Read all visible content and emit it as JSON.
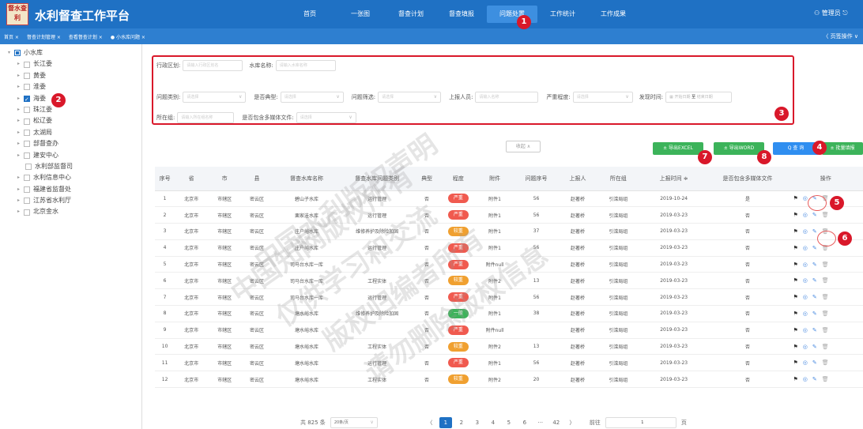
{
  "header": {
    "logo_text": "督水查利",
    "title": "水利督查工作平台",
    "user": "管理员"
  },
  "nav": {
    "items": [
      "首页",
      "一张图",
      "督查计划",
      "督查填报",
      "问题处置",
      "工作统计",
      "工作成果"
    ]
  },
  "tabs": {
    "items": [
      "首页 ×",
      "督查计划管理 ×",
      "查看督查计划 ×",
      "● 小水库问题 ×"
    ],
    "right": "〈 页签操作 ∨"
  },
  "tree": {
    "root": "小水库",
    "children": [
      "长江委",
      "黄委",
      "淮委",
      "海委",
      "珠江委",
      "松辽委",
      "太湖局",
      "部督查办",
      "建安中心"
    ],
    "leaves": [
      "水利部监督司",
      "水利信息中心",
      "福建省监督处",
      "江苏省水利厅",
      "北京金水"
    ]
  },
  "filters": {
    "region_label": "行政区划:",
    "region_ph": "请输入行政区划名",
    "reservoir_label": "水库名称:",
    "reservoir_ph": "请输入水库名称",
    "type_label": "问题类别:",
    "type_ph": "请选择",
    "typical_label": "是否典型:",
    "typical_ph": "请选择",
    "screen_label": "问题筛选:",
    "screen_ph": "请选择",
    "reporter_label": "上报人员:",
    "reporter_ph": "请输入名称",
    "severity_label": "严重程度:",
    "severity_ph": "请选择",
    "date_label": "发现时间:",
    "date_start": "开始日期",
    "date_sep": "至",
    "date_end": "结束日期",
    "group_label": "所在组:",
    "group_ph": "请输入所在组名称",
    "media_label": "是否包含多媒体文件:",
    "media_ph": "请选择"
  },
  "actions": {
    "collapse": "收起 ∧",
    "export_excel": "± 导出EXCEL",
    "export_word": "± 导出WORD",
    "query": "Q 查 询",
    "batch": "± 批量填报"
  },
  "table": {
    "headers": [
      "序号",
      "省",
      "市",
      "县",
      "督查水库名称",
      "督查水库问题类别",
      "典型",
      "程度",
      "附件",
      "问题序号",
      "上报人",
      "所在组",
      "上报时间 ≑",
      "是否包含多媒体文件",
      "操作"
    ],
    "rows": [
      [
        "1",
        "北京市",
        "市辖区",
        "密云区",
        "碧山子水库",
        "运行管理",
        "否",
        "严重",
        "附件1",
        "56",
        "赵著桥",
        "引滦局组",
        "2019-10-24",
        "是"
      ],
      [
        "2",
        "北京市",
        "市辖区",
        "密云区",
        "栗家洼水库",
        "运行管理",
        "否",
        "严重",
        "附件1",
        "56",
        "赵著桥",
        "引滦局组",
        "2019-03-23",
        "否"
      ],
      [
        "3",
        "北京市",
        "市辖区",
        "密云区",
        "庄户峪水库",
        "维修养护及除险加固",
        "否",
        "较重",
        "附件1",
        "37",
        "赵著桥",
        "引滦局组",
        "2019-03-23",
        "否"
      ],
      [
        "4",
        "北京市",
        "市辖区",
        "密云区",
        "庄户峪水库",
        "运行管理",
        "否",
        "严重",
        "附件1",
        "56",
        "赵著桥",
        "引滦局组",
        "2019-03-23",
        "否"
      ],
      [
        "5",
        "北京市",
        "市辖区",
        "密云区",
        "司马台水库一库",
        "",
        "否",
        "严重",
        "附件null",
        "",
        "赵著桥",
        "引滦局组",
        "2019-03-23",
        "否"
      ],
      [
        "6",
        "北京市",
        "市辖区",
        "密云区",
        "司马台水库一库",
        "工程实体",
        "否",
        "较重",
        "附件2",
        "13",
        "赵著桥",
        "引滦局组",
        "2019-03-23",
        "否"
      ],
      [
        "7",
        "北京市",
        "市辖区",
        "密云区",
        "司马台水库一库",
        "运行管理",
        "否",
        "严重",
        "附件1",
        "56",
        "赵著桥",
        "引滦局组",
        "2019-03-23",
        "否"
      ],
      [
        "8",
        "北京市",
        "市辖区",
        "密云区",
        "塘水峪水库",
        "维修养护及除险加固",
        "否",
        "一般",
        "附件1",
        "38",
        "赵著桥",
        "引滦局组",
        "2019-03-23",
        "否"
      ],
      [
        "9",
        "北京市",
        "市辖区",
        "密云区",
        "塘水峪水库",
        "",
        "否",
        "严重",
        "附件null",
        "",
        "赵著桥",
        "引滦局组",
        "2019-03-23",
        "否"
      ],
      [
        "10",
        "北京市",
        "市辖区",
        "密云区",
        "塘水峪水库",
        "工程实体",
        "否",
        "较重",
        "附件2",
        "13",
        "赵著桥",
        "引滦局组",
        "2019-03-23",
        "否"
      ],
      [
        "11",
        "北京市",
        "市辖区",
        "密云区",
        "塘水峪水库",
        "运行管理",
        "否",
        "严重",
        "附件1",
        "56",
        "赵著桥",
        "引滦局组",
        "2019-03-23",
        "否"
      ],
      [
        "12",
        "北京市",
        "市辖区",
        "密云区",
        "塘水峪水库",
        "工程实体",
        "否",
        "较重",
        "附件2",
        "20",
        "赵著桥",
        "引滦局组",
        "2019-03-23",
        "否"
      ]
    ]
  },
  "severity_colors": {
    "严重": "#f05a4f",
    "较重": "#f0a030",
    "一般": "#3cb35a"
  },
  "pager": {
    "total": "共 825 条",
    "size": "20条/页",
    "pages": [
      "1",
      "2",
      "3",
      "4",
      "5",
      "6",
      "···",
      "42"
    ],
    "prev": "〈",
    "next": "〉",
    "goto": "前往",
    "page_val": "1",
    "page_unit": "页"
  },
  "annotations": [
    "1",
    "2",
    "3",
    "4",
    "5",
    "6",
    "7",
    "8"
  ],
  "watermark": [
    "中国知网版权所有",
    "仅供学习和交流",
    "版权归编者所有",
    "请勿删除版权信息",
    "中国水利版权声明"
  ]
}
